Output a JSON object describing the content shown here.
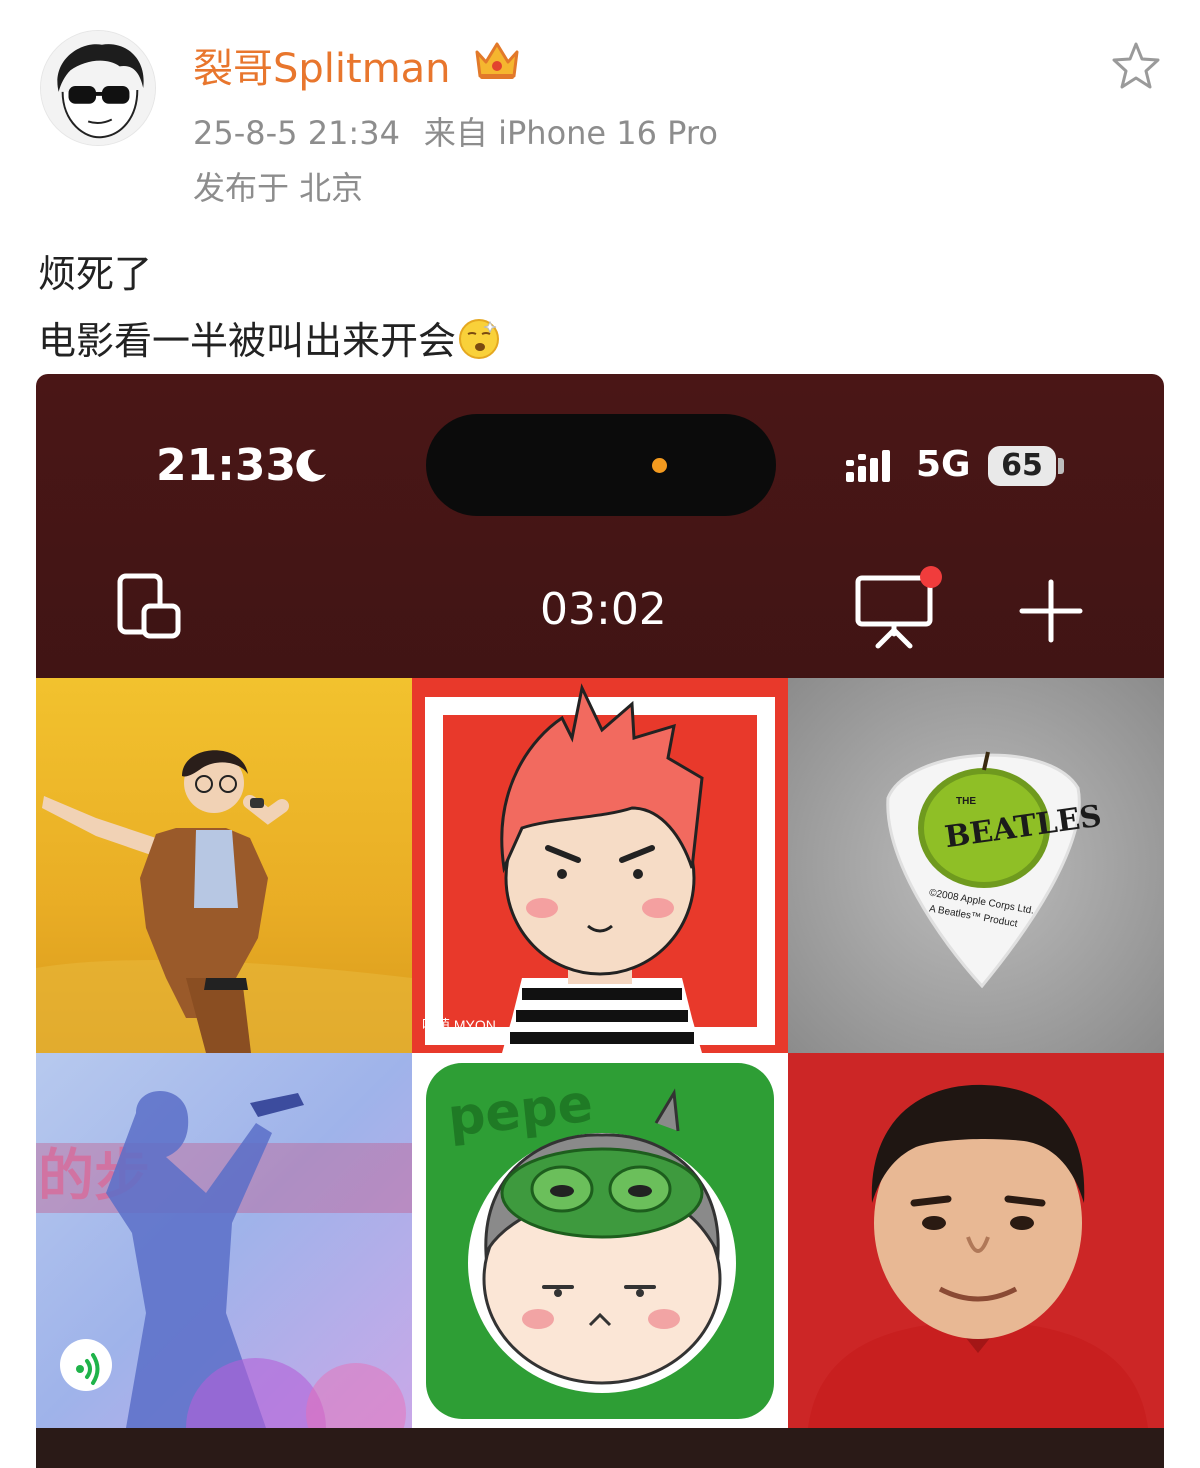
{
  "post": {
    "username": "裂哥Splitman",
    "date": "25-8-5 21:34",
    "source": "来自 iPhone 16 Pro",
    "location": "发布于 北京",
    "text_line1": "烦死了",
    "text_line2": "电影看一半被叫出来开会",
    "emoji": "yawn-emoji",
    "colors": {
      "username": "#e8762d",
      "meta": "#8d8d8d"
    }
  },
  "screenshot": {
    "status_time": "21:33",
    "network": "5G",
    "battery": "65",
    "meeting_timer": "03:02",
    "icons": [
      "moon-icon",
      "signal-icon",
      "screen-switch-icon",
      "share-screen-icon",
      "add-icon",
      "speaking-icon"
    ],
    "tiles": {
      "t1": "animated-singer-avatar",
      "t2": "red-haired-cartoon-avatar",
      "t2_watermark": "喵萌 MYON",
      "t3": "beatles-guitar-pick",
      "t3_brand": "BEATLES",
      "t3_small": "THE",
      "t3_copyright": "©2008 Apple Corps Ltd.",
      "t3_product": "A Beatles™ Product",
      "t4": "concert-silhouette",
      "t4_text": "的步",
      "t5": "pepe-cartoon-avatar",
      "t5_text": "pepe",
      "t6": "portrait-man-red"
    }
  }
}
